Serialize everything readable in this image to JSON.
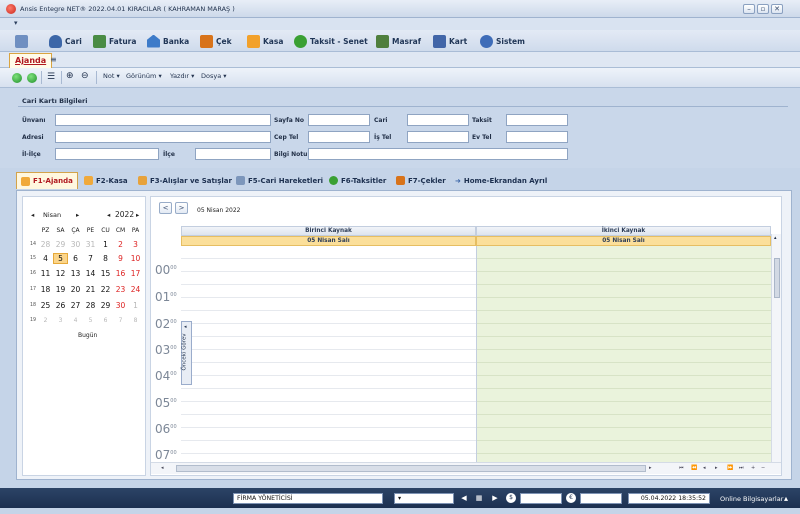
{
  "window": {
    "title": "Ansis Entegre NET® 2022.04.01 KIRACILAR ( KAHRAMAN MARAŞ )",
    "controls": [
      "–",
      "▫",
      "✕"
    ]
  },
  "ribbon": {
    "items": [
      {
        "label": "",
        "icon": "clipboard-icon",
        "color": "#5b7fb5"
      },
      {
        "label": "Cari",
        "icon": "user-icon",
        "color": "#3d67a8"
      },
      {
        "label": "Fatura",
        "icon": "invoice-icon",
        "color": "#4a8c44"
      },
      {
        "label": "Banka",
        "icon": "bank-icon",
        "color": "#3d7bc9"
      },
      {
        "label": "Çek",
        "icon": "pen-icon",
        "color": "#d8731a"
      },
      {
        "label": "Kasa",
        "icon": "safe-icon",
        "color": "#f2a12b"
      },
      {
        "label": "Taksit - Senet",
        "icon": "calendar-money-icon",
        "color": "#3aa033"
      },
      {
        "label": "Masraf",
        "icon": "chart-icon",
        "color": "#4f7f3d"
      },
      {
        "label": "Kart",
        "icon": "card-icon",
        "color": "#4266a8"
      },
      {
        "label": "Sistem",
        "icon": "gear-icon",
        "color": "#3f6db8"
      }
    ]
  },
  "tabs": {
    "active": "Ajanda",
    "pin": "≡"
  },
  "toolbar": {
    "items": [
      "Not",
      "Görünüm",
      "Yazdır",
      "Dosya"
    ]
  },
  "form": {
    "title": "Cari Kartı Bilgileri",
    "fields": {
      "unvani": "Ünvanı",
      "adresi": "Adresi",
      "il_ilce": "İl-İlçe",
      "ilce": "İlçe",
      "sayfa_no": "Sayfa No",
      "cep_tel": "Cep Tel",
      "bilgi_notu": "Bilgi Notu",
      "cari": "Cari",
      "is_tel": "İş Tel",
      "taksit": "Taksit",
      "ev_tel": "Ev Tel"
    }
  },
  "subtabs": [
    {
      "label": "F1-Ajanda",
      "icon": "agenda-icon",
      "color": "#f0a93a"
    },
    {
      "label": "F2-Kasa",
      "icon": "safe-icon",
      "color": "#f0a93a"
    },
    {
      "label": "F3-Alışlar ve Satışlar",
      "icon": "basket-icon",
      "color": "#e7a23b"
    },
    {
      "label": "F5-Cari Hareketleri",
      "icon": "list-icon",
      "color": "#7c96bb"
    },
    {
      "label": "F6-Taksitler",
      "icon": "installment-icon",
      "color": "#3aa033"
    },
    {
      "label": "F7-Çekler",
      "icon": "check-icon",
      "color": "#d8731a"
    },
    {
      "label": "Home-Ekrandan Ayrıl",
      "icon": "exit-arrow-icon",
      "color": "#3d67a8"
    }
  ],
  "calendar": {
    "month": "Nisan",
    "year": "2022",
    "weekdays": [
      "PZ",
      "SA",
      "ÇA",
      "PE",
      "CU",
      "CM",
      "PA"
    ],
    "weeks": [
      {
        "no": "14",
        "days": [
          "28",
          "29",
          "30",
          "31",
          "1",
          "2",
          "3"
        ]
      },
      {
        "no": "15",
        "days": [
          "4",
          "5",
          "6",
          "7",
          "8",
          "9",
          "10"
        ]
      },
      {
        "no": "16",
        "days": [
          "11",
          "12",
          "13",
          "14",
          "15",
          "16",
          "17"
        ]
      },
      {
        "no": "17",
        "days": [
          "18",
          "19",
          "20",
          "21",
          "22",
          "23",
          "24"
        ]
      },
      {
        "no": "18",
        "days": [
          "25",
          "26",
          "27",
          "28",
          "29",
          "30",
          "1"
        ]
      },
      {
        "no": "19",
        "days": [
          "2",
          "3",
          "4",
          "5",
          "6",
          "7",
          "8"
        ]
      }
    ],
    "today_label": "Bugün"
  },
  "scheduler": {
    "date": "05 Nisan 2022",
    "resources": [
      {
        "name": "Birinci Kaynak",
        "day": "05 Nisan Salı"
      },
      {
        "name": "İkinci Kaynak",
        "day": "05 Nisan Salı"
      }
    ],
    "hours": [
      "00",
      "01",
      "02",
      "03",
      "04",
      "05",
      "06",
      "07"
    ],
    "minutes": "00",
    "prev_task": "Önceki Görev"
  },
  "statusbar": {
    "company": "FİRMA YÖNETİCİSİ",
    "datetime": "05.04.2022  18:35:52",
    "online": "Online Bilgisayarlar"
  }
}
